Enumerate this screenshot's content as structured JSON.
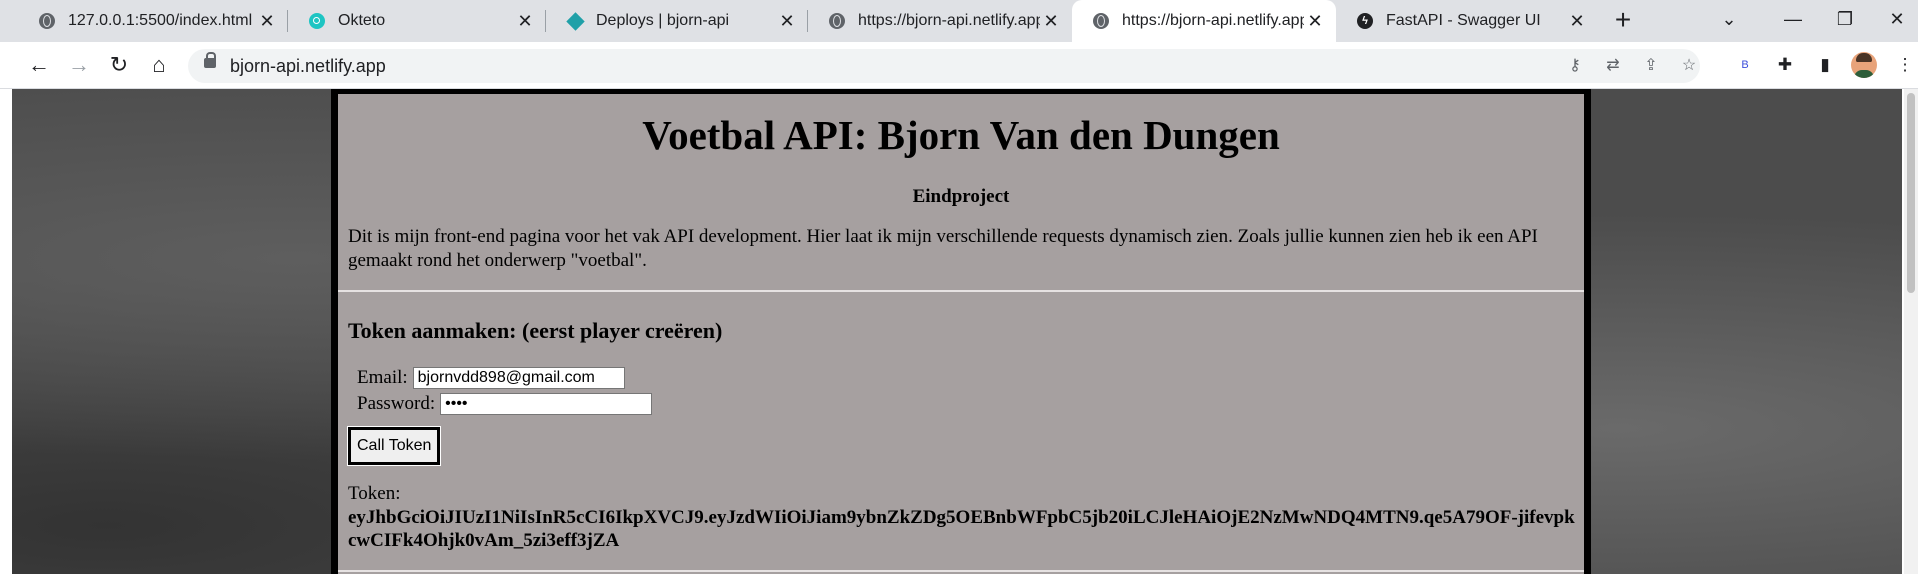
{
  "browser": {
    "tabs": [
      {
        "title": "127.0.0.1:5500/index.html",
        "icon": "globe-icon"
      },
      {
        "title": "Okteto",
        "icon": "okteto-icon"
      },
      {
        "title": "Deploys | bjorn-api",
        "icon": "netlify-icon"
      },
      {
        "title": "https://bjorn-api.netlify.app",
        "icon": "globe-icon"
      },
      {
        "title": "https://bjorn-api.netlify.app",
        "icon": "globe-icon",
        "active": true
      },
      {
        "title": "FastAPI - Swagger UI",
        "icon": "fastapi-icon"
      }
    ],
    "url": "bjorn-api.netlify.app",
    "extension_badge": "B"
  },
  "page": {
    "title": "Voetbal API: Bjorn Van den Dungen",
    "subtitle": "Eindproject",
    "intro": "Dit is mijn front-end pagina voor het vak API development. Hier laat ik mijn verschillende requests dynamisch zien. Zoals jullie kunnen zien heb ik een API gemaakt rond het onderwerp \"voetbal\".",
    "token_section": {
      "heading": "Token aanmaken: (eerst player creëren)",
      "email_label": "Email:",
      "email_value": "bjornvdd898@gmail.com",
      "password_label": "Password:",
      "password_value": "test",
      "button_label": "Call Token",
      "token_label": "Token:",
      "token_value": "eyJhbGciOiJIUzI1NiIsInR5cCI6IkpXVCJ9.eyJzdWIiOiJiam9ybnZkZDg5OEBnbWFpbC5jb20iLCJleHAiOjE2NzMwNDQ4MTN9.qe5A79OF-jifevpkcwCIFk4Ohjk0vAm_5zi3eff3jZA"
    }
  }
}
